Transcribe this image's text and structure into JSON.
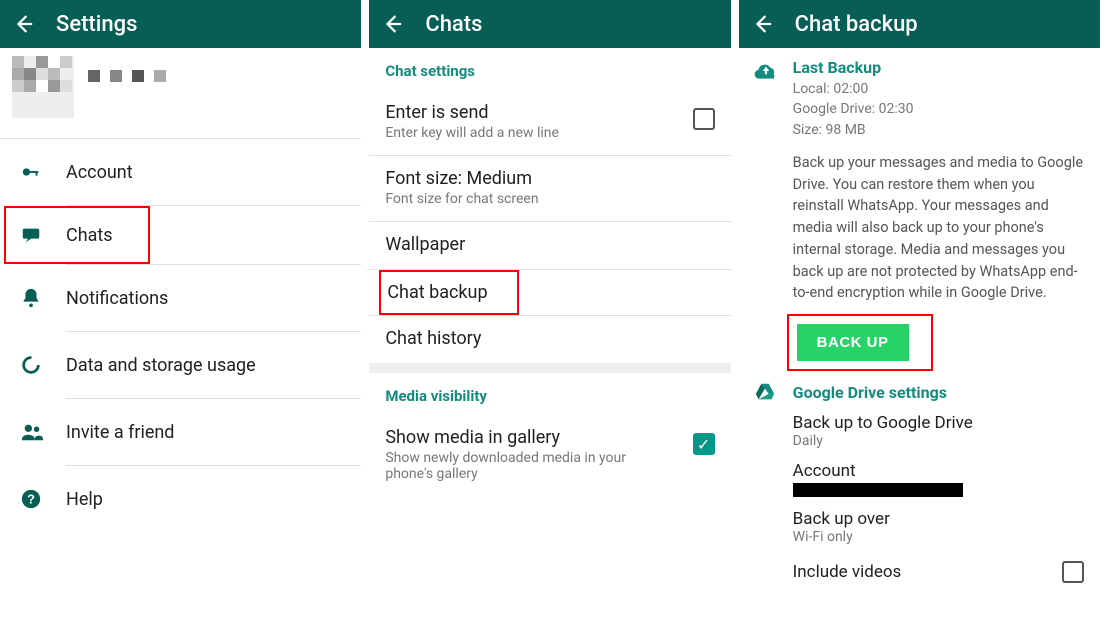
{
  "panel1": {
    "title": "Settings",
    "items": [
      {
        "label": "Account"
      },
      {
        "label": "Chats"
      },
      {
        "label": "Notifications"
      },
      {
        "label": "Data and storage usage"
      },
      {
        "label": "Invite a friend"
      },
      {
        "label": "Help"
      }
    ]
  },
  "panel2": {
    "title": "Chats",
    "chatSettingsHeader": "Chat settings",
    "enterSend": {
      "title": "Enter is send",
      "sub": "Enter key will add a new line"
    },
    "fontSize": {
      "title": "Font size: Medium",
      "sub": "Font size for chat screen"
    },
    "wallpaper": "Wallpaper",
    "chatBackup": "Chat backup",
    "chatHistory": "Chat history",
    "mediaHeader": "Media visibility",
    "mediaItem": {
      "title": "Show media in gallery",
      "sub": "Show newly downloaded media in your phone's gallery"
    }
  },
  "panel3": {
    "title": "Chat backup",
    "last": {
      "head": "Last Backup",
      "local": "Local: 02:00",
      "gdrive": "Google Drive: 02:30",
      "size": "Size: 98 MB"
    },
    "desc": "Back up your messages and media to Google Drive. You can restore them when you reinstall WhatsApp. Your messages and media will also back up to your phone's internal storage. Media and messages you back up are not protected by WhatsApp end-to-end encryption while in Google Drive.",
    "backupBtn": "BACK UP",
    "gdriveHeader": "Google Drive settings",
    "backupTo": {
      "t": "Back up to Google Drive",
      "s": "Daily"
    },
    "account": {
      "t": "Account"
    },
    "backupOver": {
      "t": "Back up over",
      "s": "Wi-Fi only"
    },
    "includeVideos": "Include videos"
  }
}
